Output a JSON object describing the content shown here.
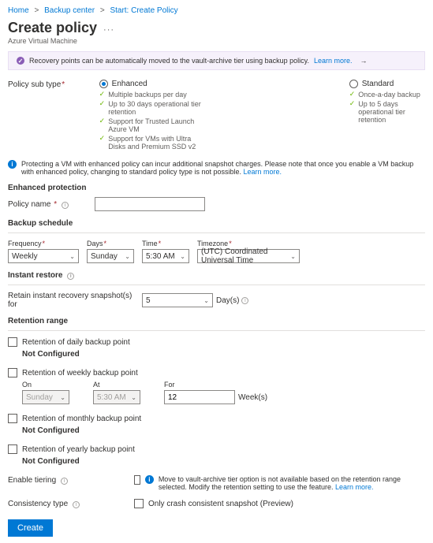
{
  "breadcrumb": {
    "home": "Home",
    "backup_center": "Backup center",
    "start": "Start: Create Policy"
  },
  "title": "Create policy",
  "subtitle": "Azure Virtual Machine",
  "banner": {
    "text": "Recovery points can be automatically moved to the vault-archive tier using backup policy.",
    "learn": "Learn more."
  },
  "policy_sub_type": {
    "label": "Policy sub type",
    "enhanced": {
      "title": "Enhanced",
      "b1": "Multiple backups per day",
      "b2": "Up to 30 days operational tier retention",
      "b3": "Support for Trusted Launch Azure VM",
      "b4": "Support for VMs with Ultra Disks and Premium SSD v2"
    },
    "standard": {
      "title": "Standard",
      "b1": "Once-a-day backup",
      "b2": "Up to 5 days operational tier retention"
    }
  },
  "warning": {
    "text": "Protecting a VM with enhanced policy can incur additional snapshot charges. Please note that once you enable a VM backup with enhanced policy, changing to standard policy type is not possible.",
    "learn": "Learn more."
  },
  "enhanced_protection": {
    "heading": "Enhanced protection",
    "policy_name_label": "Policy name",
    "policy_name_value": ""
  },
  "backup_schedule": {
    "heading": "Backup schedule",
    "frequency": {
      "label": "Frequency",
      "value": "Weekly"
    },
    "days": {
      "label": "Days",
      "value": "Sunday"
    },
    "time": {
      "label": "Time",
      "value": "5:30 AM"
    },
    "timezone": {
      "label": "Timezone",
      "value": "(UTC) Coordinated Universal Time"
    }
  },
  "instant_restore": {
    "heading": "Instant restore",
    "label": "Retain instant recovery snapshot(s) for",
    "value": "5",
    "unit": "Day(s)"
  },
  "retention": {
    "heading": "Retention range",
    "daily": {
      "label": "Retention of daily backup point",
      "status": "Not Configured"
    },
    "weekly": {
      "label": "Retention of weekly backup point",
      "on": {
        "label": "On",
        "value": "Sunday"
      },
      "at": {
        "label": "At",
        "value": "5:30 AM"
      },
      "for": {
        "label": "For",
        "value": "12",
        "unit": "Week(s)"
      }
    },
    "monthly": {
      "label": "Retention of monthly backup point",
      "status": "Not Configured"
    },
    "yearly": {
      "label": "Retention of yearly backup point",
      "status": "Not Configured"
    }
  },
  "enable_tiering": {
    "label": "Enable tiering",
    "msg": "Move to vault-archive tier option is not available based on the retention range selected. Modify the retention setting to use the feature.",
    "learn": "Learn more."
  },
  "consistency": {
    "label": "Consistency type",
    "option": "Only crash consistent snapshot (Preview)"
  },
  "create_btn": "Create"
}
